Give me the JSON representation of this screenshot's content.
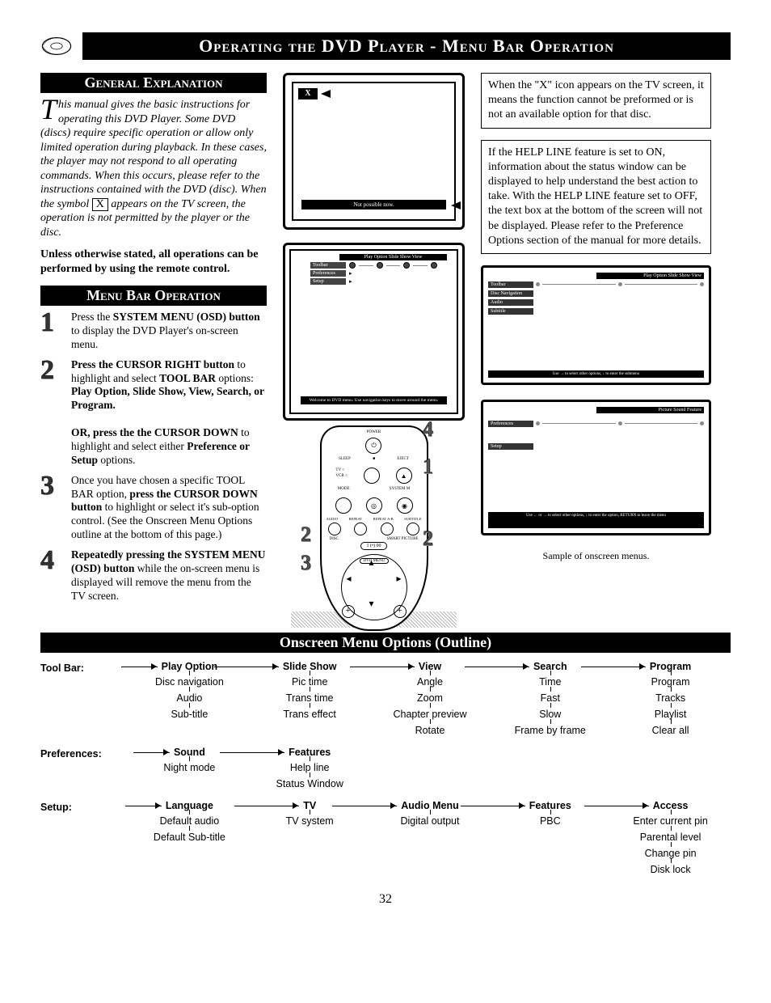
{
  "page_title": "Operating the DVD Player - Menu Bar Operation",
  "page_number": "32",
  "general": {
    "header": "General Explanation",
    "intro_first": "T",
    "intro_rest": "his manual gives the basic instructions for operating this DVD Player. Some DVD (discs) require specific operation or allow only limited operation during playback. In these cases, the player may not respond to all operating commands. When this occurs, please refer to the instructions contained with the DVD (disc). When the symbol ",
    "intro_after_x": " appears on the TV screen, the operation is not permitted by the player or the disc.",
    "bold_note": "Unless otherwise stated, all operations can be performed by using the remote control."
  },
  "menubar": {
    "header": "Menu Bar Operation",
    "steps": [
      {
        "num": "1",
        "html": "Press the <b>SYSTEM MENU (OSD) button</b> to display the DVD Player's on-screen menu."
      },
      {
        "num": "2",
        "html": "<b>Press the CURSOR RIGHT button</b> to highlight and select <b>TOOL BAR</b> options: <b>Play Option, Slide Show, View, Search, or Program.</b><br><br><b>OR, press the the CURSOR DOWN</b> to highlight and select either <b>Preference or Setup</b> options."
      },
      {
        "num": "3",
        "html": "Once you have chosen a specific TOOL BAR option, <b>press the CURSOR DOWN button</b> to highlight or select it's sub-option control. (See the Onscreen Menu Options outline at the bottom of this page.)"
      },
      {
        "num": "4",
        "html": "<b>Repeatedly pressing the SYSTEM MENU (OSD) button</b> while the on-screen menu is displayed will remove the menu from the TV screen."
      }
    ]
  },
  "screen1": {
    "x_label": "X",
    "status": "Not possible now."
  },
  "screen2": {
    "tabs": "Play Option  Slide Show  View",
    "rows": [
      "Toolbar",
      "Preferences",
      "Setup"
    ],
    "help": "Welcome to DVD menu. Use navigation keys to move around the menu."
  },
  "box_x": "When the \"X\" icon appears on the TV screen, it means the function cannot be preformed or is not an available option for that disc.",
  "box_help": "If the HELP LINE feature is set to ON, information about the status window can be displayed to help understand the best action to take. With the HELP LINE feature set to OFF, the text box at the bottom of the screen will not be displayed. Please refer to the Preference Options section of the manual for more details.",
  "mini_menu1": {
    "tabs": "Play Option    Slide Show   View",
    "rows": [
      "Toolbar",
      "Disc Navigation",
      "Audio",
      "Subtitle"
    ],
    "help": "Use → to select other options, ↓ to enter the submenu"
  },
  "mini_menu2": {
    "tabs": "Picture      Sound      Feature",
    "rows": [
      "Preferences",
      "Setup"
    ],
    "help": "Use ← or → to select other options, ↓ to enter the option, RETURN to leave the menu"
  },
  "sample_caption": "Sample of onscreen menus.",
  "remote_labels": {
    "power": "POWER",
    "sleep": "SLEEP",
    "eject": "EJECT",
    "tv": "TV",
    "vcr": "VCR",
    "mode": "MODE",
    "system": "SYSTEM M",
    "audio": "AUDIO",
    "repeat": "REPEAT",
    "repeat_ab": "REPEAT A-B",
    "subtitle": "SUBTITLE",
    "disc": "DISC",
    "smart": "SMART PICTURE",
    "dvd_menu": "DVD MENU"
  },
  "outline": {
    "header": "Onscreen Menu Options (Outline)",
    "rows": [
      {
        "label": "Tool Bar:",
        "groups": [
          {
            "head": "Play Option",
            "items": [
              "Disc navigation",
              "Audio",
              "Sub-title"
            ]
          },
          {
            "head": "Slide Show",
            "items": [
              "Pic time",
              "Trans time",
              "Trans effect"
            ]
          },
          {
            "head": "View",
            "items": [
              "Angle",
              "Zoom",
              "Chapter preview",
              "Rotate"
            ]
          },
          {
            "head": "Search",
            "items": [
              "Time",
              "Fast",
              "Slow",
              "Frame by frame"
            ]
          },
          {
            "head": "Program",
            "items": [
              "Program",
              "Tracks",
              "Playlist",
              "Clear all"
            ]
          }
        ]
      },
      {
        "label": "Preferences:",
        "groups": [
          {
            "head": "Sound",
            "items": [
              "Night mode"
            ]
          },
          {
            "head": "Features",
            "items": [
              "Help line",
              "Status Window"
            ]
          },
          {
            "head": "",
            "items": []
          },
          {
            "head": "",
            "items": []
          },
          {
            "head": "",
            "items": []
          }
        ]
      },
      {
        "label": "Setup:",
        "groups": [
          {
            "head": "Language",
            "items": [
              "Default audio",
              "Default Sub-title"
            ]
          },
          {
            "head": "TV",
            "items": [
              "TV system"
            ]
          },
          {
            "head": "Audio Menu",
            "items": [
              "Digital output"
            ]
          },
          {
            "head": "Features",
            "items": [
              "PBC"
            ]
          },
          {
            "head": "Access",
            "items": [
              "Enter current pin",
              "Parental level",
              "Change pin",
              "Disk lock"
            ]
          }
        ]
      }
    ]
  }
}
